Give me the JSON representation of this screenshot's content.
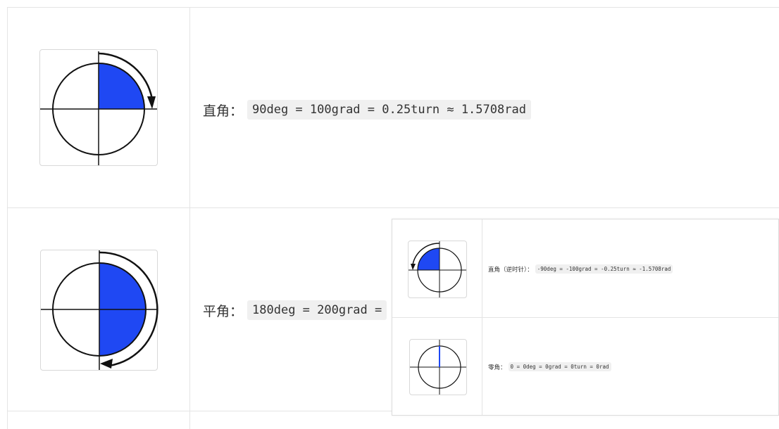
{
  "rows": [
    {
      "label": "直角：",
      "code": "90deg = 100grad = 0.25turn ≈ 1.5708rad",
      "icon": "right-angle-icon"
    },
    {
      "label": "平角：",
      "code": "180deg = 200grad =",
      "icon": "straight-angle-icon"
    }
  ],
  "overlay": {
    "rows": [
      {
        "label": "直角（逆时针）：",
        "code": "-90deg = -100grad = -0.25turn ≈ -1.5708rad",
        "icon": "counterclockwise-right-angle-icon"
      },
      {
        "label": "零角：",
        "code": "0 = 0deg = 0grad = 0turn = 0rad",
        "icon": "zero-angle-icon"
      }
    ]
  },
  "colors": {
    "fill": "#1f48f3",
    "stroke": "#111111",
    "border": "#e4e4e4"
  }
}
